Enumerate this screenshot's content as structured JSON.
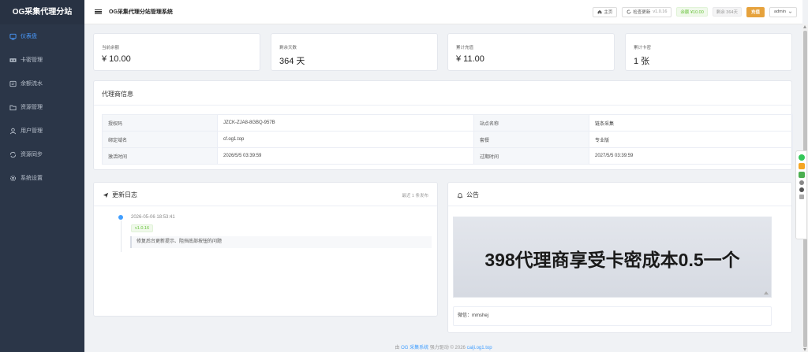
{
  "sidebar": {
    "logo": "OG采集代理分站",
    "items": [
      {
        "label": "仪表盘",
        "icon": "dashboard-icon"
      },
      {
        "label": "卡密管理",
        "icon": "card-icon"
      },
      {
        "label": "余额流水",
        "icon": "wallet-icon"
      },
      {
        "label": "资源管理",
        "icon": "folder-icon"
      },
      {
        "label": "用户管理",
        "icon": "user-icon"
      },
      {
        "label": "资源同步",
        "icon": "sync-icon"
      },
      {
        "label": "系统设置",
        "icon": "gear-icon"
      }
    ]
  },
  "topbar": {
    "title": "OG采集代理分站管理系统",
    "home_label": "主页",
    "update_label": "检查更新",
    "version": "v1.0.16",
    "balance_badge": "余额 ¥10.00",
    "days_badge": "剩余 364天",
    "recharge_label": "充值",
    "user_label": "admin"
  },
  "stats": [
    {
      "label": "当前余额",
      "value": "¥ 10.00"
    },
    {
      "label": "剩余天数",
      "value": "364 天"
    },
    {
      "label": "累计充值",
      "value": "¥ 11.00"
    },
    {
      "label": "累计卡密",
      "value": "1 张"
    }
  ],
  "agent_info": {
    "title": "代理商信息",
    "rows": [
      {
        "k1": "授权码",
        "v1": "JZCK-ZJA8-8GBQ-957B",
        "k2": "站点名称",
        "v2": "链条采集"
      },
      {
        "k1": "绑定域名",
        "v1": "cf.og1.top",
        "k2": "套餐",
        "v2": "专业版"
      },
      {
        "k1": "激活时间",
        "v1": "2026/5/5 03:39:59",
        "k2": "过期时间",
        "v2": "2027/5/5 03:39:59"
      }
    ]
  },
  "changelog": {
    "title": "更新日志",
    "right_label": "最近 1 条发布",
    "entries": [
      {
        "time": "2026-05-06 18:53:41",
        "version": "v1.0.16",
        "note": "修复后台更新提示、阻挡底部按钮的问题"
      }
    ]
  },
  "notice": {
    "title": "公告",
    "banner_text": "398代理商享受卡密成本0.5一个",
    "wechat": "微信：mmshej"
  },
  "footer": {
    "prefix": "由",
    "system_link": "OG 采集系统",
    "middle": "强力驱动",
    "copyright": "© 2026",
    "site_link": "caiji.og1.top"
  },
  "colors": {
    "sidebar_bg": "#2b3648",
    "accent": "#409eff",
    "success": "#67c23a",
    "warning": "#e6a23c"
  }
}
